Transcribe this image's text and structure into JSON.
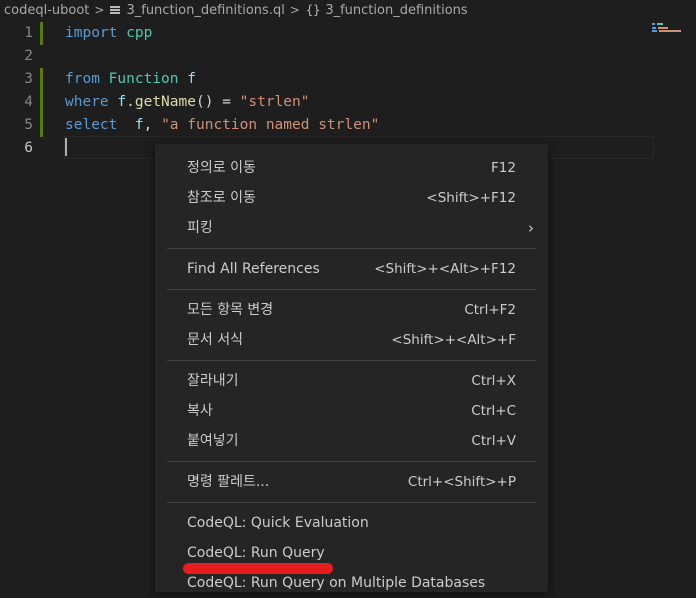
{
  "breadcrumb": {
    "folder": "codeql-uboot",
    "file": "3_function_definitions.ql",
    "symbol": "3_function_definitions"
  },
  "editor": {
    "lines": [
      {
        "num": "1",
        "tokens": [
          {
            "t": "import",
            "c": "kw"
          },
          {
            "t": " ",
            "c": "pl"
          },
          {
            "t": "cpp",
            "c": "ty"
          }
        ]
      },
      {
        "num": "2",
        "tokens": []
      },
      {
        "num": "3",
        "tokens": [
          {
            "t": "from",
            "c": "kw"
          },
          {
            "t": " ",
            "c": "pl"
          },
          {
            "t": "Function",
            "c": "ty"
          },
          {
            "t": " ",
            "c": "pl"
          },
          {
            "t": "f",
            "c": "id"
          }
        ]
      },
      {
        "num": "4",
        "tokens": [
          {
            "t": "where",
            "c": "kw"
          },
          {
            "t": " ",
            "c": "pl"
          },
          {
            "t": "f",
            "c": "id"
          },
          {
            "t": ".",
            "c": "pl"
          },
          {
            "t": "getName",
            "c": "fn"
          },
          {
            "t": "() = ",
            "c": "pl"
          },
          {
            "t": "\"strlen\"",
            "c": "str"
          }
        ]
      },
      {
        "num": "5",
        "tokens": [
          {
            "t": "select",
            "c": "kw"
          },
          {
            "t": "  ",
            "c": "pl"
          },
          {
            "t": "f",
            "c": "id"
          },
          {
            "t": ", ",
            "c": "pl"
          },
          {
            "t": "\"a function named strlen\"",
            "c": "str"
          }
        ]
      },
      {
        "num": "6",
        "tokens": []
      }
    ]
  },
  "context_menu": {
    "groups": [
      [
        {
          "label": "정의로 이동",
          "shortcut": "F12"
        },
        {
          "label": "참조로 이동",
          "shortcut": "<Shift>+F12"
        },
        {
          "label": "피킹",
          "submenu": "›"
        }
      ],
      [
        {
          "label": "Find All References",
          "shortcut": "<Shift>+<Alt>+F12"
        }
      ],
      [
        {
          "label": "모든 항목 변경",
          "shortcut": "Ctrl+F2"
        },
        {
          "label": "문서 서식",
          "shortcut": "<Shift>+<Alt>+F"
        }
      ],
      [
        {
          "label": "잘라내기",
          "shortcut": "Ctrl+X"
        },
        {
          "label": "복사",
          "shortcut": "Ctrl+C"
        },
        {
          "label": "붙여넣기",
          "shortcut": "Ctrl+V"
        }
      ],
      [
        {
          "label": "명령 팔레트...",
          "shortcut": "Ctrl+<Shift>+P"
        }
      ],
      [
        {
          "label": "CodeQL: Quick Evaluation"
        },
        {
          "label": "CodeQL: Run Query"
        },
        {
          "label": "CodeQL: Run Query on Multiple Databases"
        }
      ]
    ]
  },
  "colors": {
    "background": "#1e1e1e",
    "menu_background": "#252526",
    "modified_gutter": "#587c0c",
    "highlight_underline": "#e51d1d"
  }
}
